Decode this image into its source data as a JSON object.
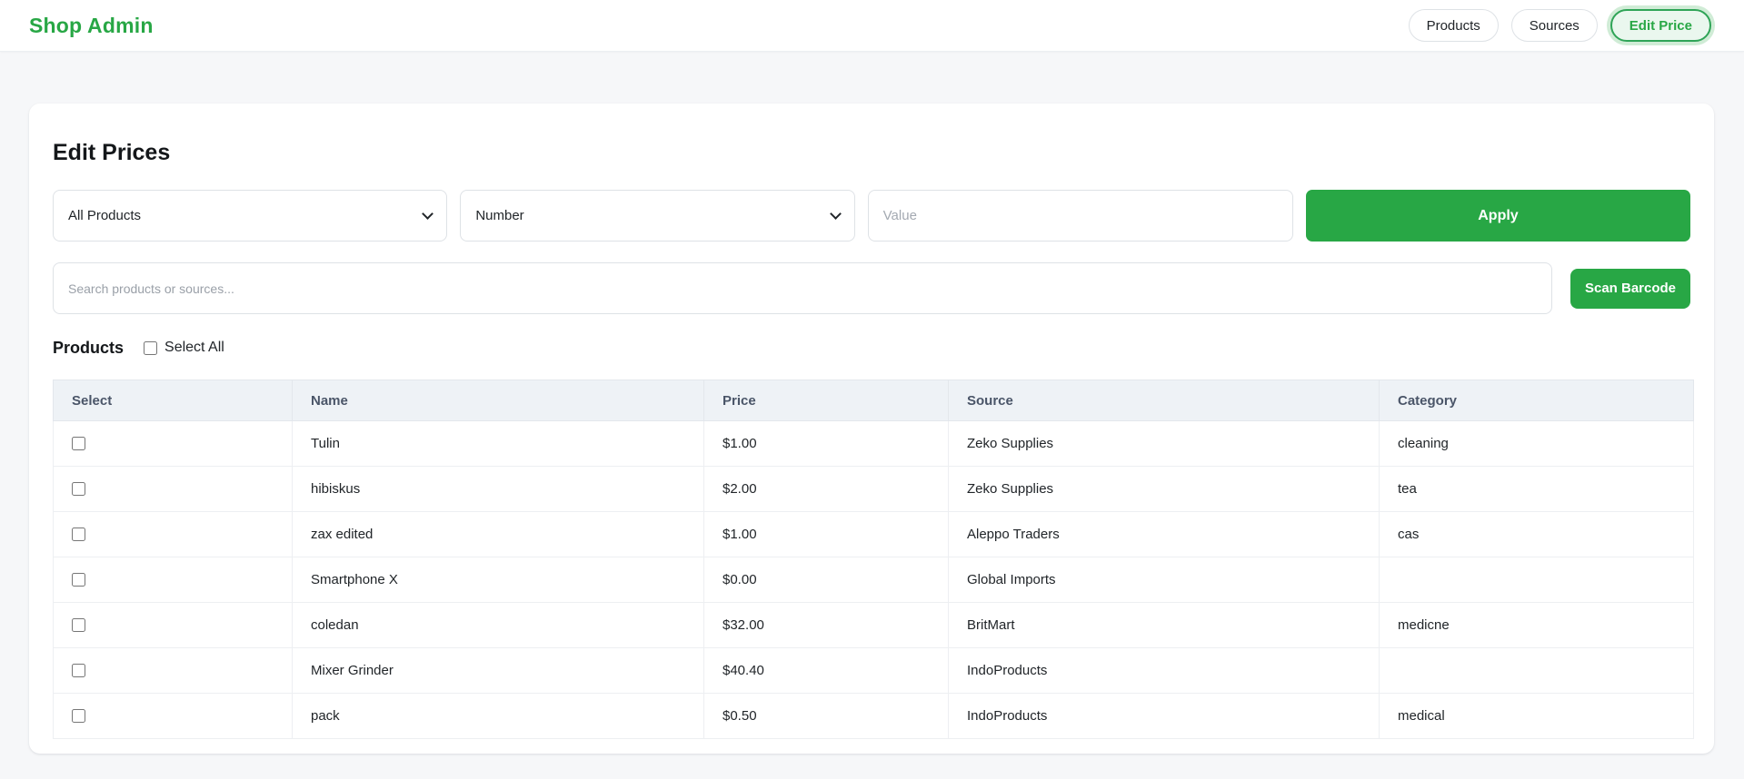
{
  "header": {
    "brand": "Shop Admin",
    "nav": [
      {
        "label": "Products",
        "active": false
      },
      {
        "label": "Sources",
        "active": false
      },
      {
        "label": "Edit Price",
        "active": true
      }
    ]
  },
  "panel": {
    "title": "Edit Prices",
    "filters": {
      "target_select": "All Products",
      "mode_select": "Number",
      "value_placeholder": "Value",
      "apply_label": "Apply"
    },
    "search": {
      "placeholder": "Search products or sources...",
      "scan_label": "Scan Barcode"
    },
    "products_section": {
      "heading": "Products",
      "select_all_label": "Select All",
      "select_all_checked": false
    },
    "table": {
      "columns": [
        "Select",
        "Name",
        "Price",
        "Source",
        "Category"
      ],
      "rows": [
        {
          "selected": false,
          "name": "Tulin",
          "price": "$1.00",
          "source": "Zeko Supplies",
          "category": "cleaning"
        },
        {
          "selected": false,
          "name": "hibiskus",
          "price": "$2.00",
          "source": "Zeko Supplies",
          "category": "tea"
        },
        {
          "selected": false,
          "name": "zax edited",
          "price": "$1.00",
          "source": "Aleppo Traders",
          "category": "cas"
        },
        {
          "selected": false,
          "name": "Smartphone X",
          "price": "$0.00",
          "source": "Global Imports",
          "category": ""
        },
        {
          "selected": false,
          "name": "coledan",
          "price": "$32.00",
          "source": "BritMart",
          "category": "medicne"
        },
        {
          "selected": false,
          "name": "Mixer Grinder",
          "price": "$40.40",
          "source": "IndoProducts",
          "category": ""
        },
        {
          "selected": false,
          "name": "pack",
          "price": "$0.50",
          "source": "IndoProducts",
          "category": "medical"
        }
      ]
    }
  },
  "colors": {
    "brand_green": "#28a745",
    "active_pill_bg": "#eaf7ee",
    "table_header_bg": "#eef2f6",
    "border": "#dee2e6",
    "page_bg": "#f6f7f9"
  }
}
